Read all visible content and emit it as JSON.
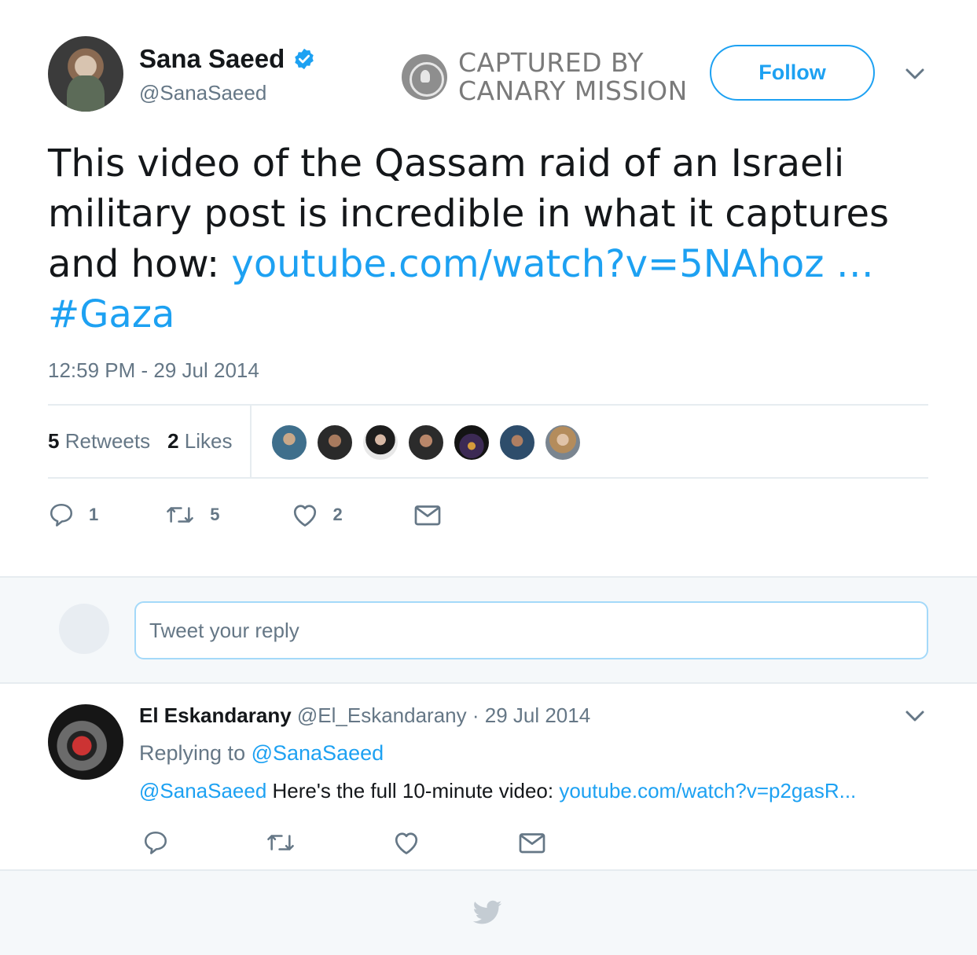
{
  "tweet": {
    "author_name": "Sana Saeed",
    "author_handle": "@SanaSaeed",
    "follow_label": "Follow",
    "text_before_link": "This video of the Qassam raid of an Israeli military post is incredible in what it captures and how: ",
    "link_text": "youtube.com/watch?v=5NAhoz …",
    "hashtag": "#Gaza",
    "timestamp": "12:59 PM - 29 Jul 2014",
    "retweets_count": "5",
    "retweets_label": "Retweets",
    "likes_count": "2",
    "likes_label": "Likes",
    "reply_count": "1",
    "retweet_count": "5",
    "like_count": "2"
  },
  "watermark": {
    "line1": "CAPTURED BY",
    "line2": "CANARY MISSION"
  },
  "reply_box": {
    "placeholder": "Tweet your reply"
  },
  "reply": {
    "author_name": "El Eskandarany",
    "author_handle": "@El_Eskandarany",
    "separator": " · ",
    "date": "29 Jul 2014",
    "replying_prefix": "Replying to ",
    "replying_to": "@SanaSaeed",
    "mention": "@SanaSaeed",
    "body": " Here's the full 10-minute video: ",
    "link_text": "youtube.com/watch?v=p2gasR..."
  },
  "colors": {
    "accent": "#1da1f2",
    "muted": "#657786",
    "text": "#14171a",
    "band": "#f5f8fa"
  },
  "icons": [
    "verified-badge-icon",
    "chevron-down-icon",
    "reply-icon",
    "retweet-icon",
    "like-icon",
    "direct-message-icon",
    "twitter-bird-icon",
    "canary-mission-logo"
  ]
}
